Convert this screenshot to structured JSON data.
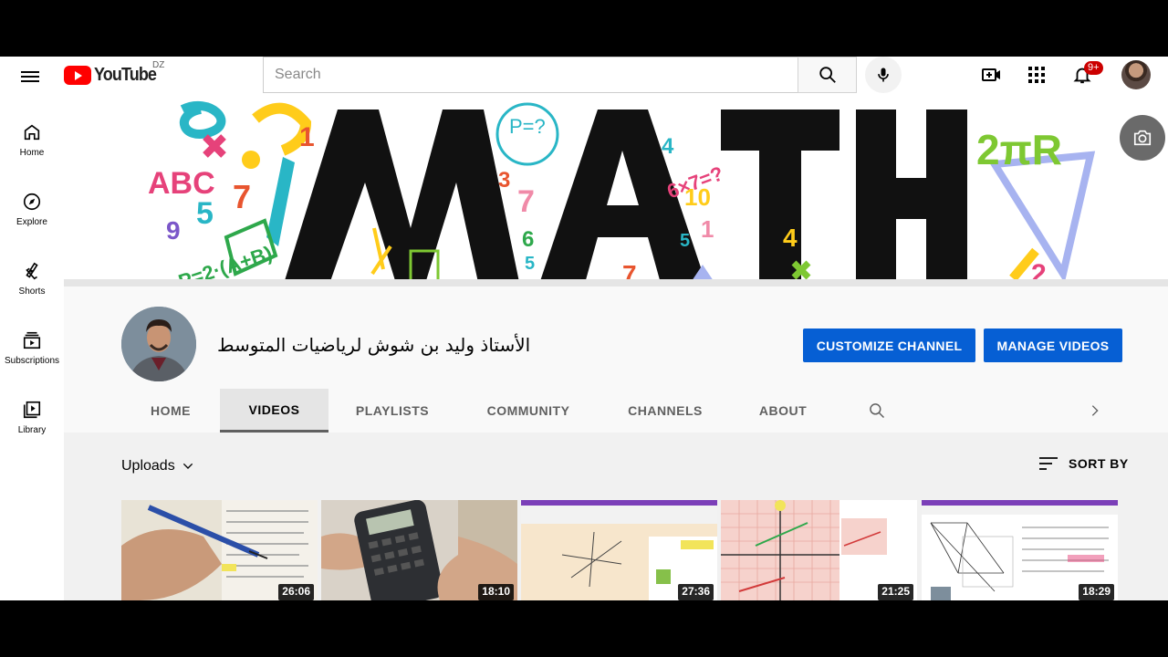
{
  "header": {
    "logo_text": "YouTube",
    "region": "DZ",
    "search_placeholder": "Search",
    "notifications_badge": "9+"
  },
  "sidebar": {
    "items": [
      {
        "label": "Home",
        "icon": "home-icon"
      },
      {
        "label": "Explore",
        "icon": "compass-icon"
      },
      {
        "label": "Shorts",
        "icon": "shorts-icon"
      },
      {
        "label": "Subscriptions",
        "icon": "subscriptions-icon"
      },
      {
        "label": "Library",
        "icon": "library-icon"
      }
    ]
  },
  "banner": {
    "title_art": "MATH",
    "decor_text": [
      "ABC",
      "2πR",
      "P=2·(A+B)",
      "6×7=?",
      "10",
      "P=?"
    ]
  },
  "channel": {
    "name": "الأستاذ وليد بن شوش لرياضيات المتوسط",
    "customize_label": "CUSTOMIZE CHANNEL",
    "manage_label": "MANAGE VIDEOS"
  },
  "tabs": [
    {
      "label": "HOME",
      "active": false
    },
    {
      "label": "VIDEOS",
      "active": true
    },
    {
      "label": "PLAYLISTS",
      "active": false
    },
    {
      "label": "COMMUNITY",
      "active": false
    },
    {
      "label": "CHANNELS",
      "active": false
    },
    {
      "label": "ABOUT",
      "active": false
    }
  ],
  "content": {
    "section_label": "Uploads",
    "sort_label": "SORT BY",
    "videos": [
      {
        "duration": "26:06"
      },
      {
        "duration": "18:10"
      },
      {
        "duration": "27:36"
      },
      {
        "duration": "21:25"
      },
      {
        "duration": "18:29"
      }
    ]
  },
  "colors": {
    "brand_red": "#ff0000",
    "primary_blue": "#065fd4",
    "badge_red": "#cc0000"
  }
}
